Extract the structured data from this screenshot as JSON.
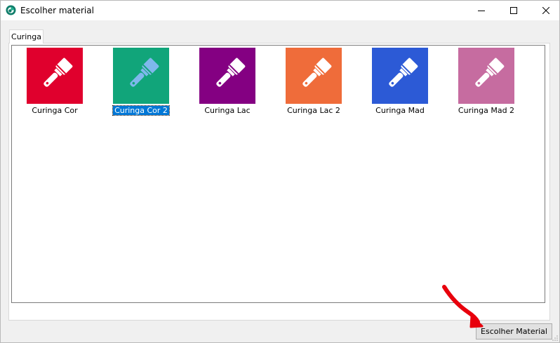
{
  "window": {
    "title": "Escolher material"
  },
  "tabs": [
    {
      "label": "Curinga"
    }
  ],
  "materials": [
    {
      "label": "Curinga Cor",
      "color": "#e0002d",
      "selected": false
    },
    {
      "label": "Curinga Cor 2",
      "color": "#11a57a",
      "selected": true
    },
    {
      "label": "Curinga Lac",
      "color": "#840082",
      "selected": false
    },
    {
      "label": "Curinga Lac 2",
      "color": "#ef6c3a",
      "selected": false
    },
    {
      "label": "Curinga Mad",
      "color": "#2c5ad6",
      "selected": false
    },
    {
      "label": "Curinga Mad 2",
      "color": "#c66ca0",
      "selected": false
    }
  ],
  "footer": {
    "choose_label": "Escolher Material"
  },
  "icons": {
    "app": "app-logo-icon",
    "material": "paintbrush-icon",
    "annotation": "red-arrow-icon"
  },
  "colors": {
    "selection": "#0078d7",
    "arrow": "#e8000c"
  }
}
